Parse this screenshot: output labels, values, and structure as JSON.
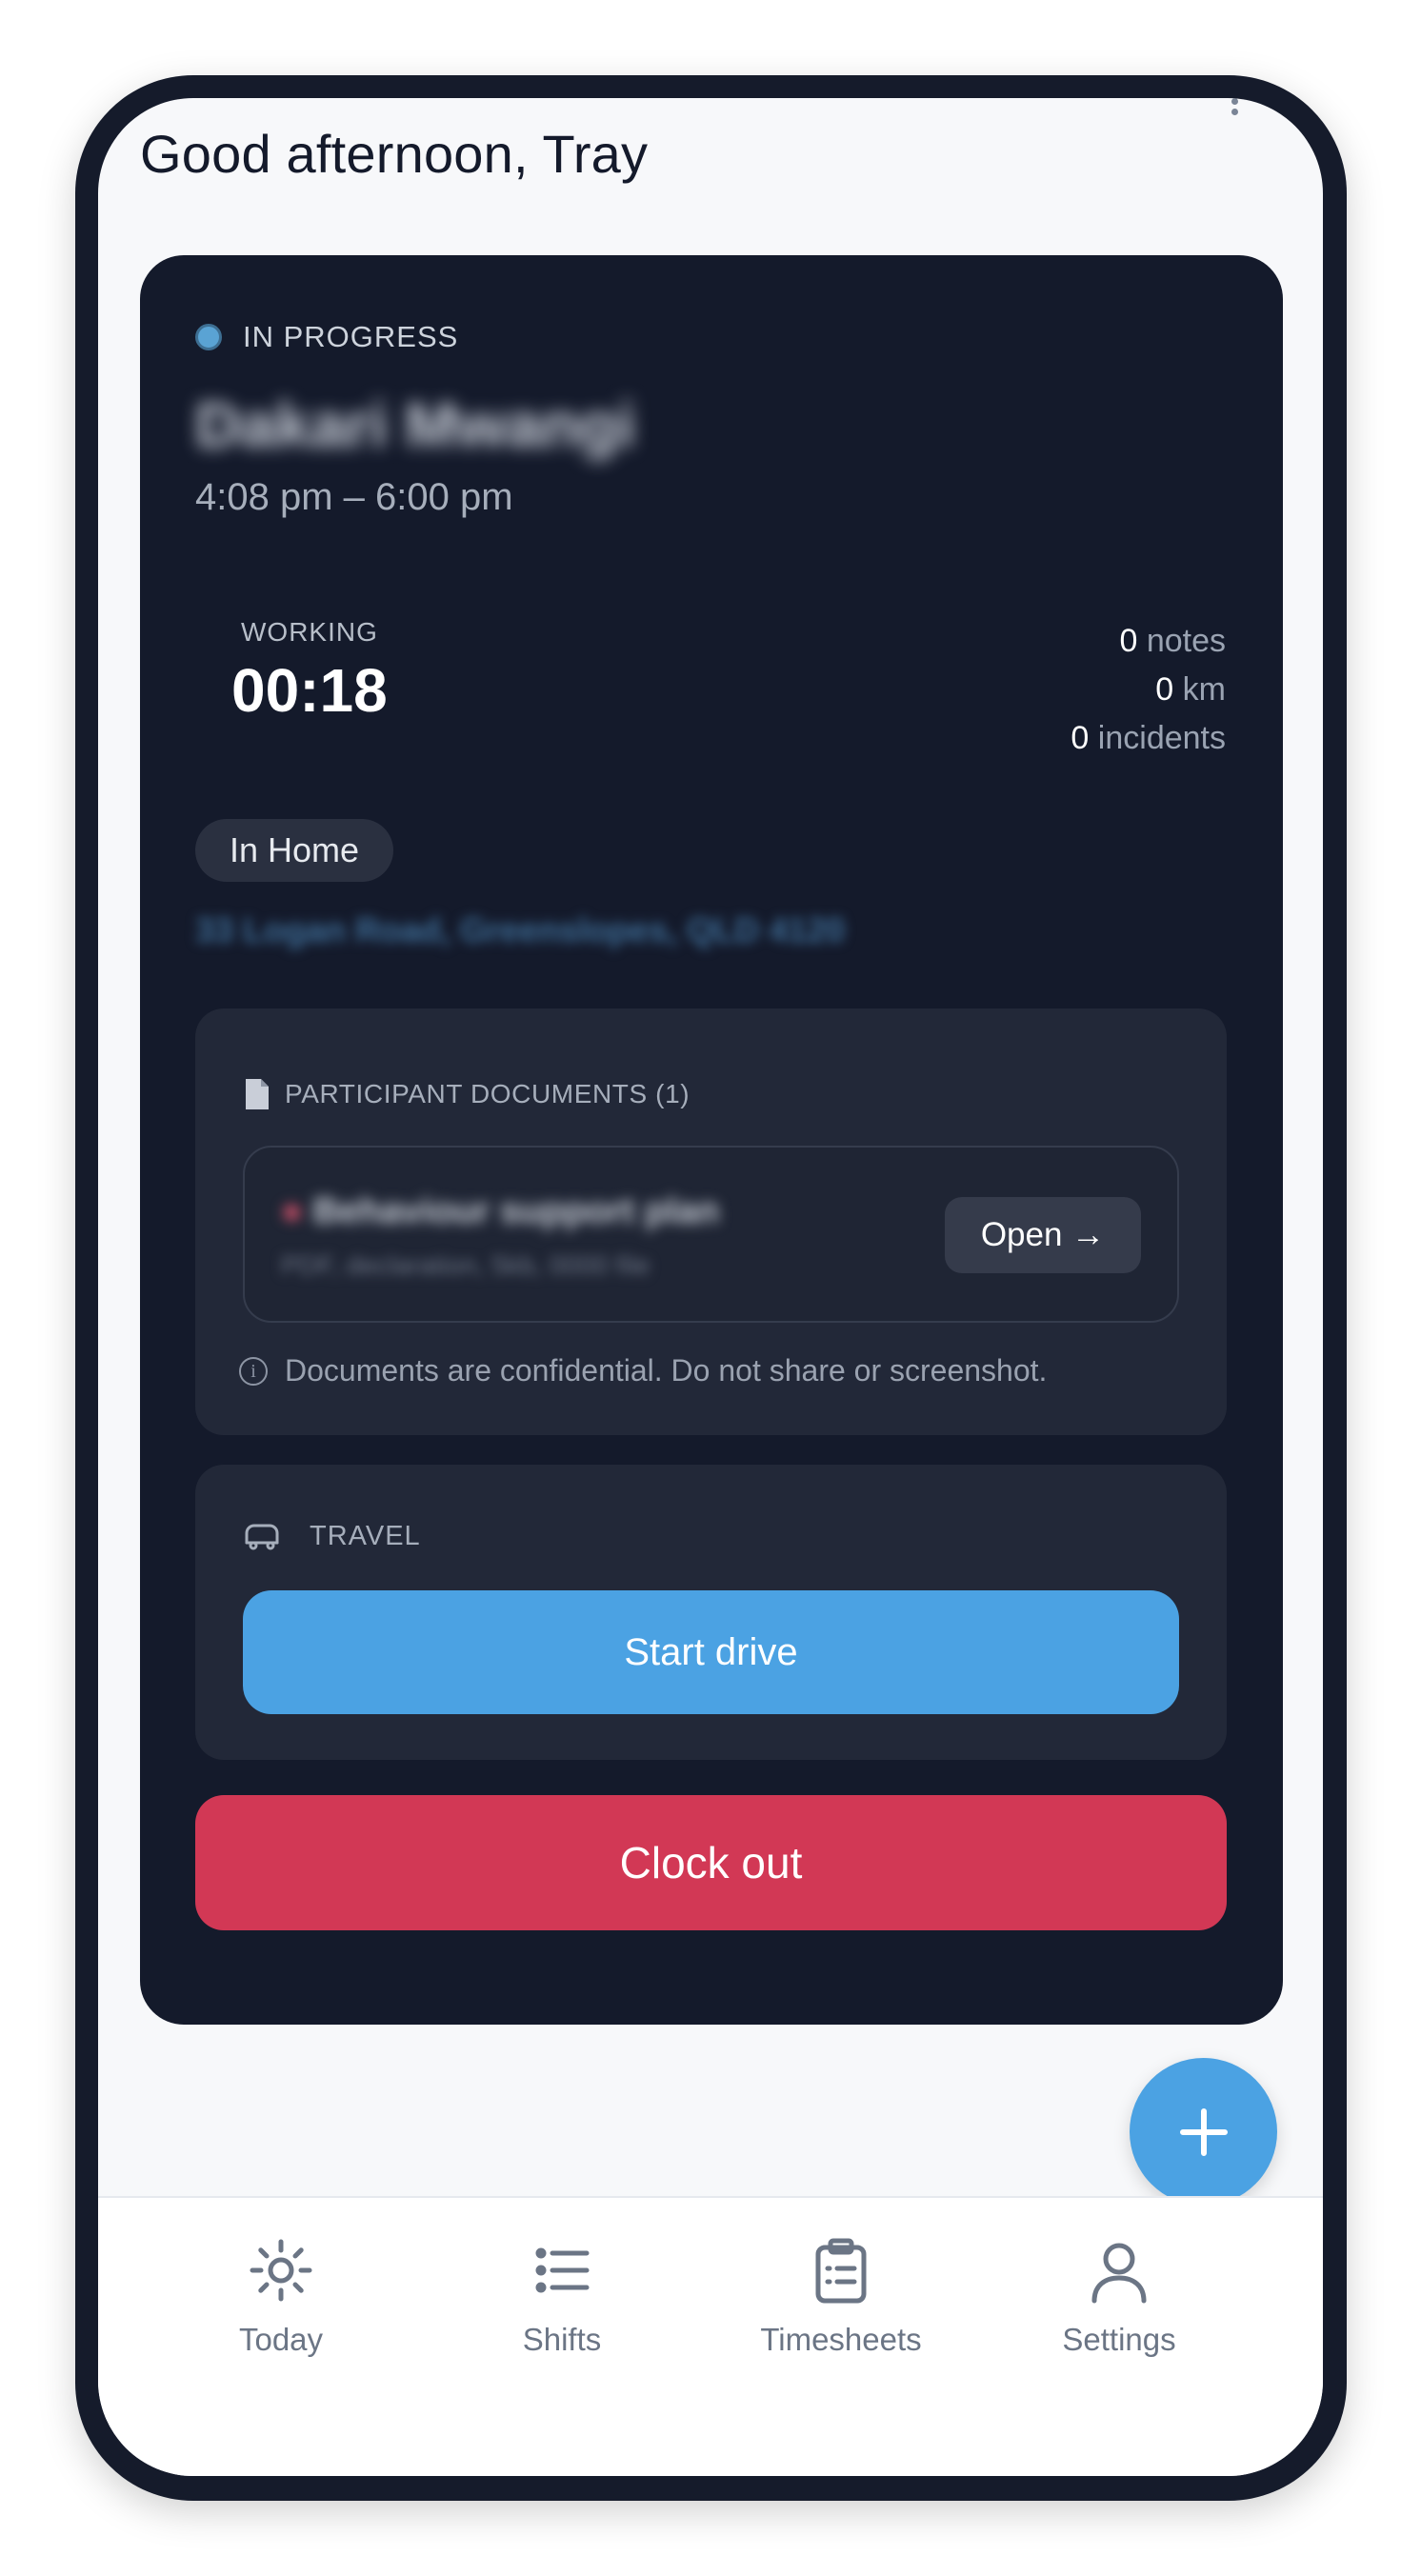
{
  "greeting": "Good afternoon, Tray",
  "shift": {
    "status": "IN PROGRESS",
    "participant_name": "Dakari Mwangi",
    "time_range": "4:08 pm – 6:00 pm",
    "working_label": "WORKING",
    "working_time": "00:18",
    "stats": [
      {
        "value": "0",
        "label": "notes"
      },
      {
        "value": "0",
        "label": "km"
      },
      {
        "value": "0",
        "label": "incidents"
      }
    ],
    "location_type": "In Home",
    "address": "33 Logan Road, Greenslopes, QLD 4120"
  },
  "documents": {
    "title": "PARTICIPANT DOCUMENTS (1)",
    "item_title": "Behaviour support plan",
    "item_meta": "PDF, declaration, 5kb, 0000 file",
    "open_label": "Open →",
    "note": "Documents are confidential. Do not share or screenshot."
  },
  "travel": {
    "title": "TRAVEL",
    "start_drive_label": "Start drive"
  },
  "clock_out_label": "Clock out",
  "nav": {
    "today": "Today",
    "shifts": "Shifts",
    "timesheets": "Timesheets",
    "settings": "Settings"
  },
  "colors": {
    "card_bg": "#141a2b",
    "accent_blue": "#4ba2e3",
    "clock_out_red": "#d23855",
    "status_dot": "#5aa3d4"
  },
  "icons": {
    "fab": "plus-icon",
    "today": "sun-icon",
    "shifts": "list-icon",
    "timesheets": "clipboard-icon",
    "settings": "user-icon",
    "documents": "document-icon",
    "travel": "car-icon",
    "note": "info-icon"
  }
}
